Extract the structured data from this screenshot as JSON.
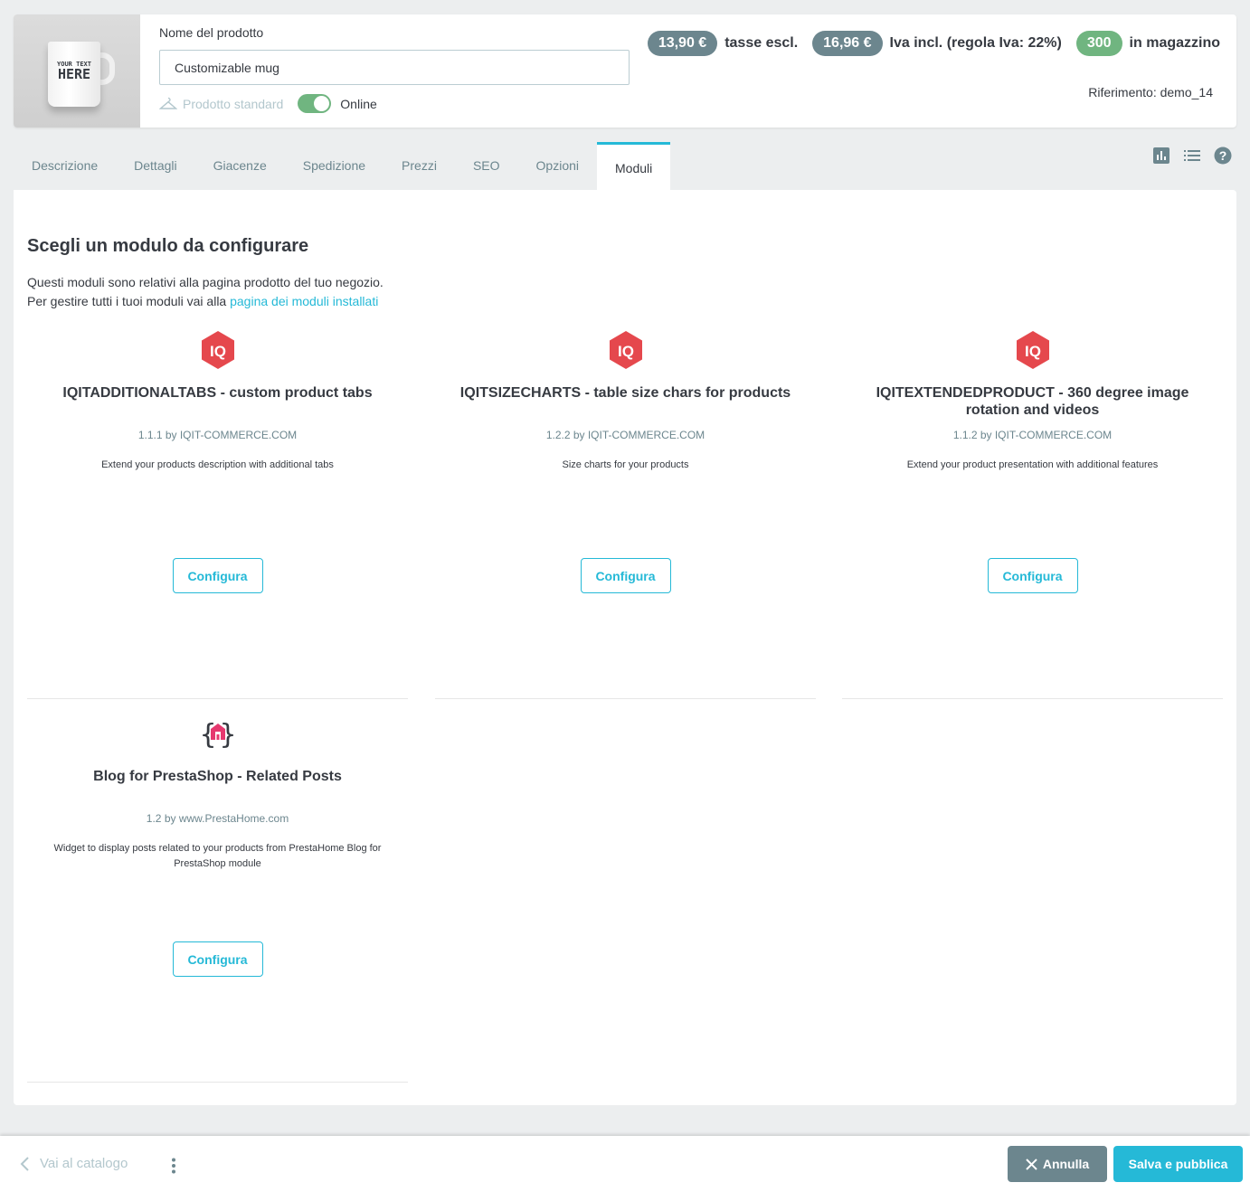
{
  "header": {
    "thumbnail_text_line1": "YOUR TEXT",
    "thumbnail_text_line2": "HERE",
    "name_label": "Nome del prodotto",
    "name_value": "Customizable mug",
    "product_type": "Prodotto standard",
    "online_label": "Online",
    "online_enabled": true,
    "price_excl": "13,90 €",
    "price_excl_label": "tasse escl.",
    "price_incl": "16,96 €",
    "price_incl_label": "Iva incl. (regola Iva: 22%)",
    "stock": "300",
    "stock_label": "in magazzino",
    "reference": "Riferimento: demo_14"
  },
  "tabs": [
    {
      "label": "Descrizione"
    },
    {
      "label": "Dettagli"
    },
    {
      "label": "Giacenze"
    },
    {
      "label": "Spedizione"
    },
    {
      "label": "Prezzi"
    },
    {
      "label": "SEO"
    },
    {
      "label": "Opzioni"
    },
    {
      "label": "Moduli",
      "active": true
    }
  ],
  "tab_icons": [
    "stats-icon",
    "list-icon",
    "help-icon"
  ],
  "main": {
    "title": "Scegli un modulo da configurare",
    "desc_line1": "Questi moduli sono relativi alla pagina prodotto del tuo negozio.",
    "desc_line2_prefix": "Per gestire tutti i tuoi moduli vai alla ",
    "desc_link": "pagina dei moduli installati",
    "modules": [
      {
        "name": "IQITADDITIONALTABS - custom product tabs",
        "version": "1.1.1 by IQIT-COMMERCE.COM",
        "description": "Extend your products description with additional tabs",
        "button": "Configura",
        "logo": "iqit-logo"
      },
      {
        "name": "IQITSIZECHARTS - table size chars for products",
        "version": "1.2.2 by IQIT-COMMERCE.COM",
        "description": "Size charts for your products",
        "button": "Configura",
        "logo": "iqit-logo"
      },
      {
        "name": "IQITEXTENDEDPRODUCT - 360 degree image rotation and videos",
        "version": "1.1.2 by IQIT-COMMERCE.COM",
        "description": "Extend your product presentation with additional features",
        "button": "Configura",
        "logo": "iqit-logo"
      },
      {
        "name": "Blog for PrestaShop - Related Posts",
        "version": "1.2 by www.PrestaHome.com",
        "description": "Widget to display posts related to your products from PrestaHome Blog for PrestaShop module",
        "button": "Configura",
        "logo": "prestahome-logo"
      }
    ]
  },
  "footer": {
    "back_label": "Vai al catalogo",
    "cancel_label": "Annulla",
    "save_label": "Salva e pubblica"
  },
  "colors": {
    "accent": "#25b9d7",
    "badge_grey": "#6c868e",
    "badge_green": "#70b580",
    "iqit_red": "#e5484d"
  }
}
